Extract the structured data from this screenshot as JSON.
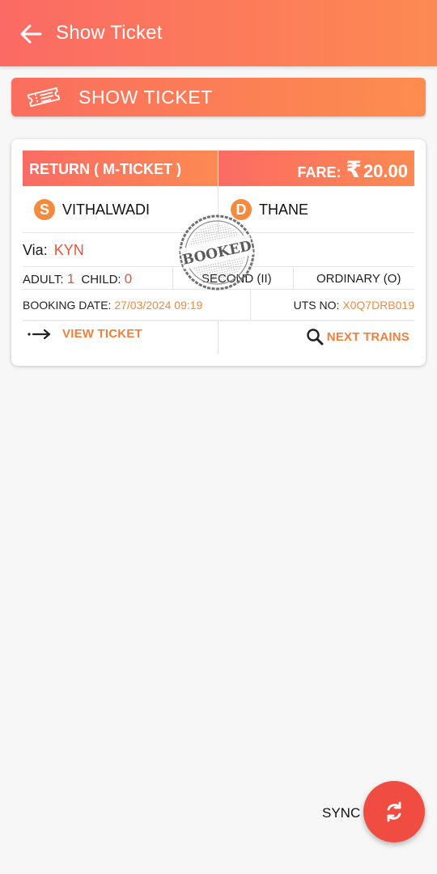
{
  "appbar": {
    "title": "Show Ticket"
  },
  "show_ticket_bar": {
    "label": "SHOW TICKET"
  },
  "ticket": {
    "type": "RETURN ( M-TICKET )",
    "fare_label": "FARE:",
    "fare_currency": "₹",
    "fare_amount": "20.00",
    "source_badge": "S",
    "source": "VITHALWADI",
    "dest_badge": "D",
    "destination": "THANE",
    "via_label": "Via:",
    "via": "KYN",
    "adult_label": "ADULT:",
    "adult_count": "1",
    "child_label": "CHILD:",
    "child_count": "0",
    "class": "SECOND (II)",
    "train_type": "ORDINARY (O)",
    "booking_date_label": "BOOKING DATE:",
    "booking_date": "27/03/2024 09:19",
    "uts_label": "UTS NO:",
    "uts_no": "X0Q7DRB019",
    "stamp_text": "BOOKED",
    "view_ticket": "VIEW TICKET",
    "next_trains": "NEXT TRAINS"
  },
  "sync": {
    "label": "SYNC"
  },
  "colors": {
    "brand_start": "#fb6a64",
    "brand_end": "#fd8a52",
    "fab": "#f04c42",
    "accent": "#f08a3c"
  },
  "icons": {
    "back": "arrow-left-icon",
    "ticket": "ticket-icon",
    "view": "arrow-right-icon",
    "search": "search-icon",
    "sync": "sync-icon"
  }
}
